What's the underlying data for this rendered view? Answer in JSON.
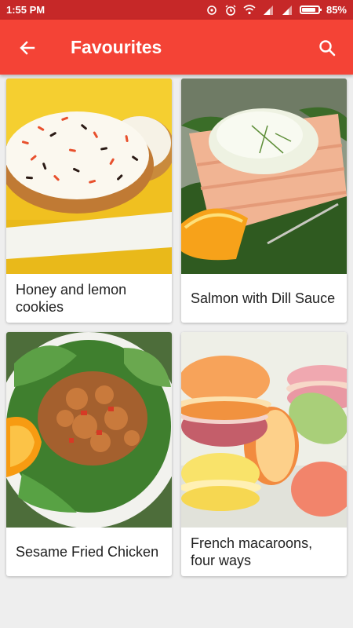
{
  "status_bar": {
    "time": "1:55 PM",
    "battery_percent": "85%",
    "battery_level": 0.85,
    "icons": [
      "data-sync-icon",
      "alarm-icon",
      "wifi-icon",
      "signal-icon",
      "signal-icon",
      "battery-icon"
    ]
  },
  "app_bar": {
    "title": "Favourites",
    "back_icon": "arrow-back-icon",
    "search_icon": "search-icon",
    "color": "#f44336"
  },
  "recipes": [
    {
      "name": "Honey and lemon cookies",
      "image": "cookies-photo"
    },
    {
      "name": "Salmon with Dill Sauce",
      "image": "salmon-photo"
    },
    {
      "name": "Sesame Fried Chicken",
      "image": "chicken-salad-photo"
    },
    {
      "name": "French macaroons, four ways",
      "image": "macarons-photo"
    }
  ]
}
